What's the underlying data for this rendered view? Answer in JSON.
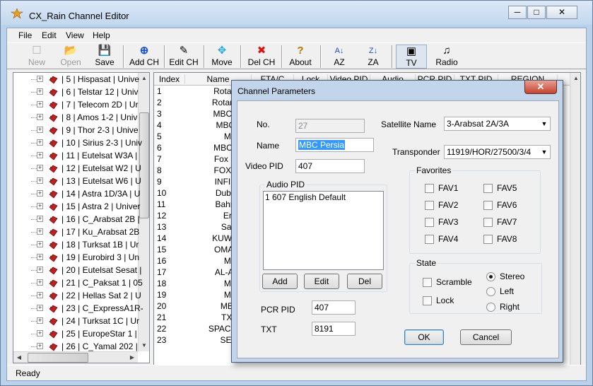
{
  "window": {
    "title": "CX_Rain Channel Editor",
    "min": "─",
    "max": "□",
    "close": "✕"
  },
  "menu": [
    "File",
    "Edit",
    "View",
    "Help"
  ],
  "toolbar": [
    {
      "label": "New",
      "icon": "☐",
      "enabled": false
    },
    {
      "label": "Open",
      "icon": "📂",
      "enabled": false
    },
    {
      "label": "Save",
      "icon": "💾",
      "enabled": true
    },
    {
      "label": "Add CH",
      "icon": "⊕",
      "enabled": true
    },
    {
      "label": "Edit CH",
      "icon": "✎",
      "enabled": true
    },
    {
      "label": "Move",
      "icon": "✥",
      "enabled": true
    },
    {
      "label": "Del CH",
      "icon": "✖",
      "enabled": true
    },
    {
      "label": "About",
      "icon": "?",
      "enabled": true
    },
    {
      "label": "AZ",
      "icon": "A↓",
      "enabled": true
    },
    {
      "label": "ZA",
      "icon": "Z↓",
      "enabled": true
    },
    {
      "label": "TV",
      "icon": "▣",
      "enabled": true
    },
    {
      "label": "Radio",
      "icon": "♫",
      "enabled": true
    }
  ],
  "tree": [
    "| 5 | Hispasat | Unive",
    "| 6 | Telstar 12 | Univ",
    "| 7 | Telecom 2D | Ur",
    "| 8 | Amos 1-2 | Univ",
    "| 9 | Thor 2-3 | Unive",
    "| 10 | Sirius 2-3 | Univ",
    "| 11 | Eutelsat W3A |",
    "| 12 | Eutelsat W2 | U",
    "| 13 | Eutelsat W6 | U",
    "| 14 | Astra 1D/3A | U",
    "| 15 | Astra 2 | Univer",
    "| 16 | C_Arabsat 2B |",
    "| 17 | Ku_Arabsat 2B",
    "| 18 | Turksat 1B | Ur",
    "| 19 | Eurobird 3 | Un",
    "| 20 | Eutelsat Sesat |",
    "| 21 | C_Paksat 1 | 05",
    "| 22 | Hellas Sat 2 | U",
    "| 23 | C_ExpressA1R-",
    "| 24 | Turksat 1C | Ur",
    "| 25 | EuropeStar 1 |",
    "| 26 | C_Yamal 202 |"
  ],
  "grid": {
    "headers": [
      "Index",
      "Name",
      "FTA/C",
      "Lock",
      "Video PID",
      "Audio",
      "PCR PID",
      "TXT PID",
      "REGION"
    ],
    "rows": [
      [
        "1",
        "Rotana Clip"
      ],
      [
        "2",
        "Rotana Musi"
      ],
      [
        "3",
        "MBC Persia"
      ],
      [
        "4",
        "MBC MAX"
      ],
      [
        "5",
        "MBC2"
      ],
      [
        "6",
        "MBC Action"
      ],
      [
        "7",
        "Fox Movies"
      ],
      [
        "8",
        "FOX Series"
      ],
      [
        "9",
        "INFINITY 2"
      ],
      [
        "10",
        "Dubai One"
      ],
      [
        "11",
        "Bahrain 55"
      ],
      [
        "12",
        "Eretria"
      ],
      [
        "13",
        "Saudi-2"
      ],
      [
        "14",
        "KUWAIT CH"
      ],
      [
        "15",
        "OMAN TV2"
      ],
      [
        "16",
        "MBC3"
      ],
      [
        "17",
        "AL-Arabiya"
      ],
      [
        "18",
        "MBC1"
      ],
      [
        "19",
        "MBC4"
      ],
      [
        "20",
        "MBC Int"
      ],
      [
        "21",
        "TXT TV"
      ],
      [
        "22",
        "SPACE TOON"
      ],
      [
        "23",
        "SERIES"
      ]
    ]
  },
  "status": "Ready",
  "dialog": {
    "title": "Channel Parameters",
    "close": "✕",
    "no_label": "No.",
    "no_value": "27",
    "name_label": "Name",
    "name_value": "MBC Persia",
    "video_pid_label": "Video PID",
    "video_pid_value": "407",
    "satellite_label": "Satellite Name",
    "satellite_value": "3-Arabsat 2A/3A",
    "transponder_label": "Transponder",
    "transponder_value": "11919/HOR/27500/3/4",
    "audio_pid_group": "Audio PID",
    "audio_pid_items": [
      "1  607  English Default"
    ],
    "add_label": "Add",
    "edit_label": "Edit",
    "del_label": "Del",
    "favorites_group": "Favorites",
    "favorites": [
      "FAV1",
      "FAV5",
      "FAV2",
      "FAV6",
      "FAV3",
      "FAV7",
      "FAV4",
      "FAV8"
    ],
    "state_group": "State",
    "scramble_label": "Scramble",
    "lock_label": "Lock",
    "sound_options": [
      "Stereo",
      "Left",
      "Right"
    ],
    "sound_selected": "Stereo",
    "pcr_pid_label": "PCR PID",
    "pcr_pid_value": "407",
    "txt_label": "TXT",
    "txt_value": "8191",
    "ok_label": "OK",
    "cancel_label": "Cancel"
  }
}
